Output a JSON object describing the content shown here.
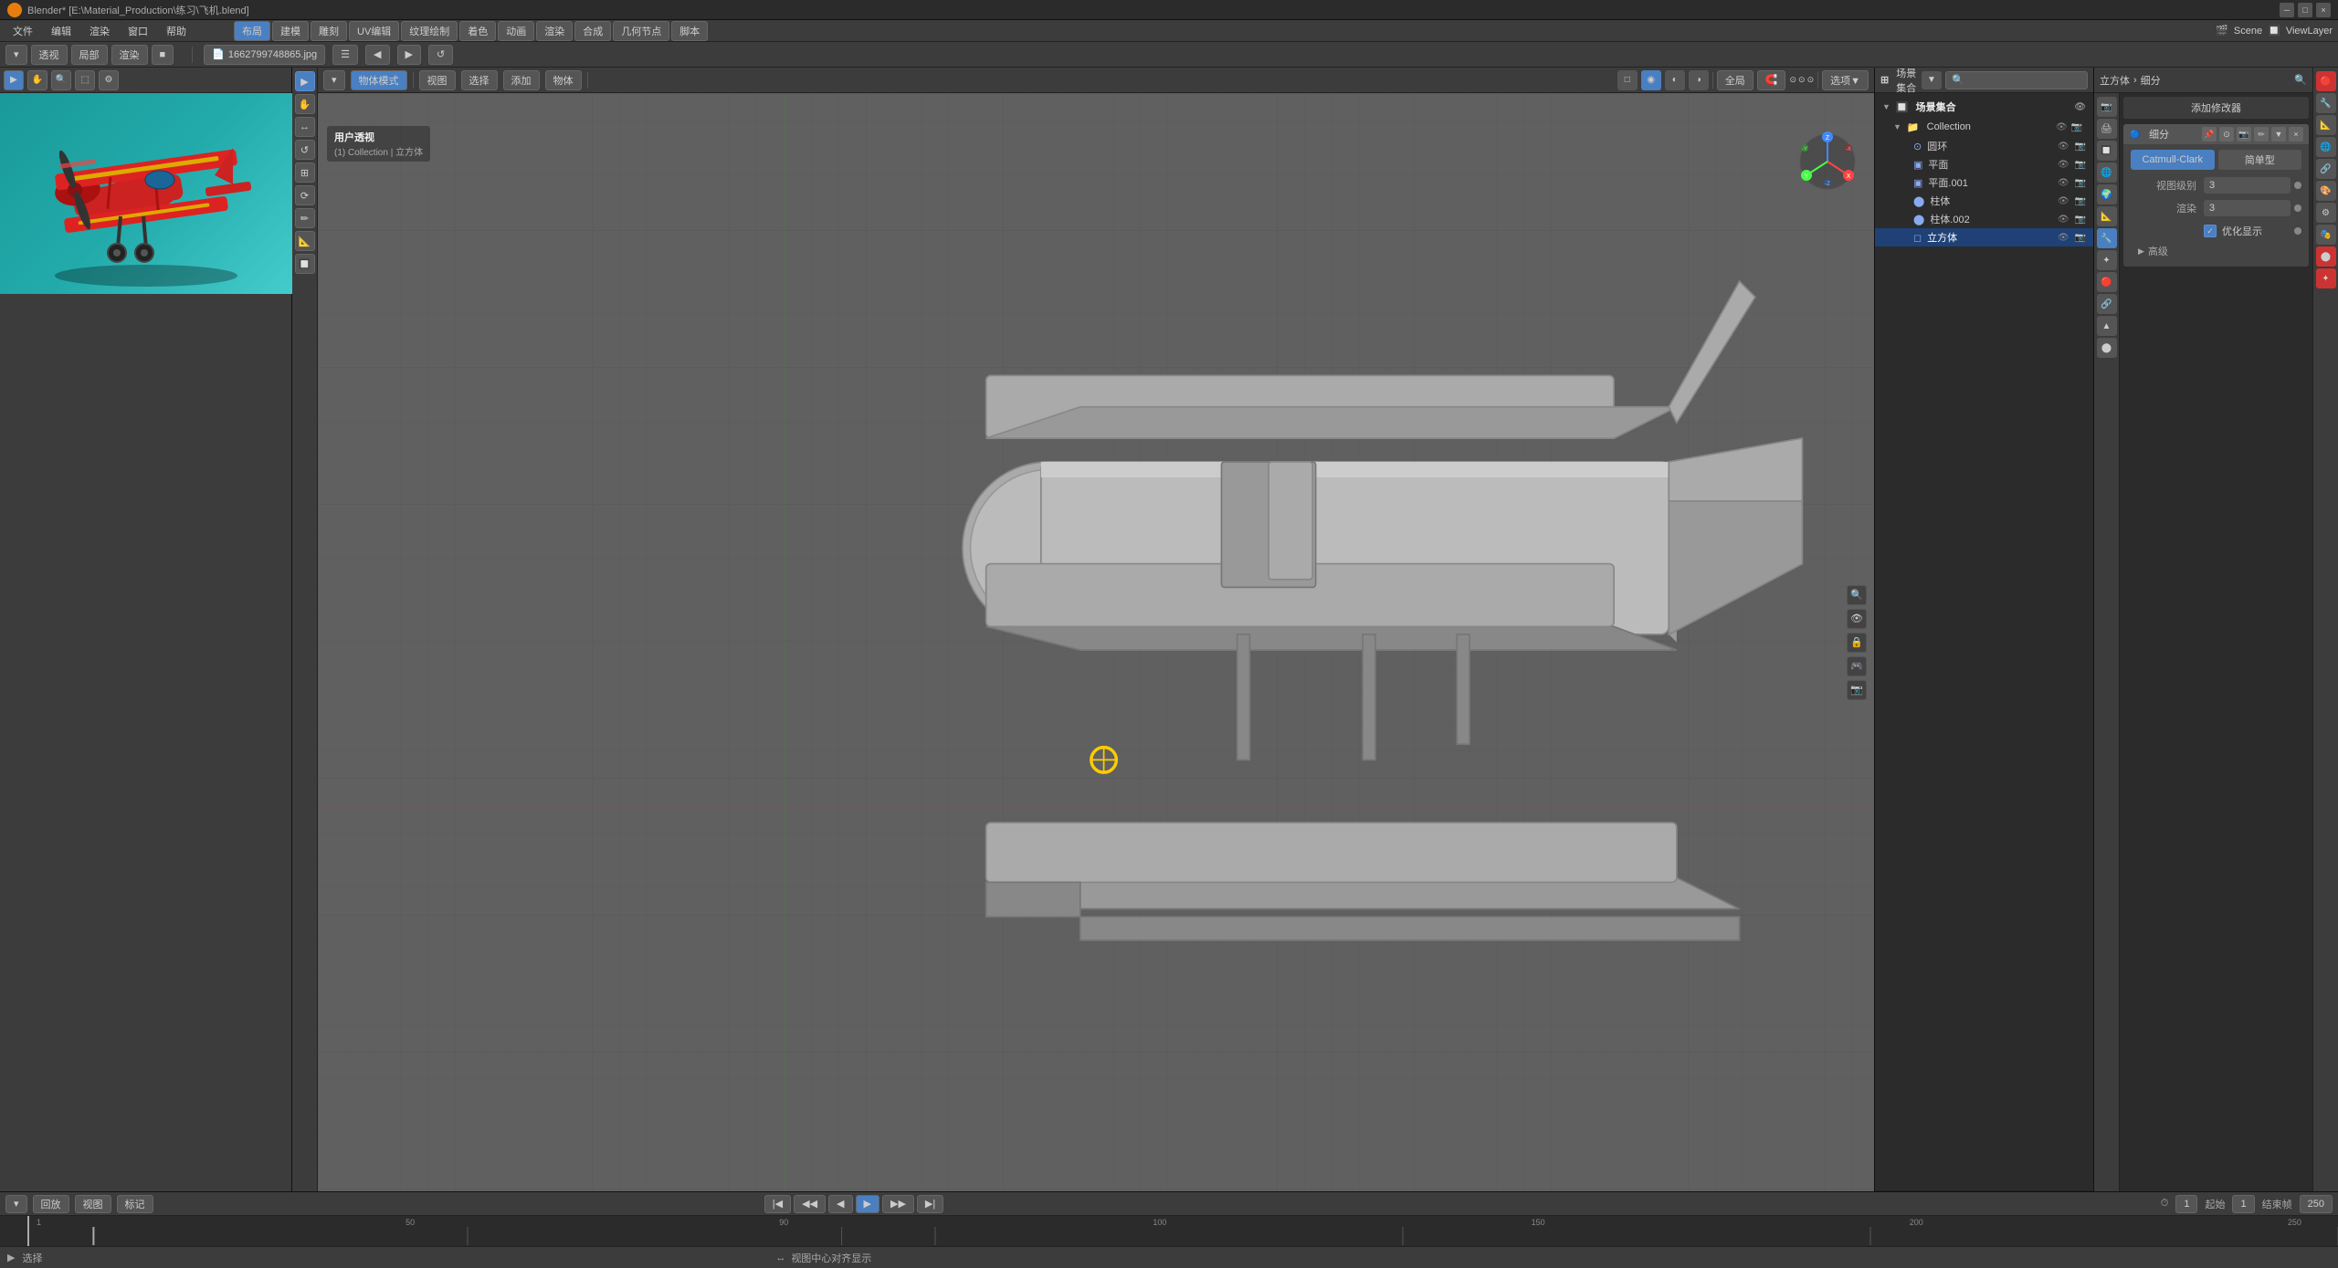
{
  "titleBar": {
    "title": "Blender* [E:\\Material_Production\\练习\\飞机.blend]",
    "icon": "blender-icon"
  },
  "menuBar": {
    "items": [
      "文件",
      "编辑",
      "渲染",
      "窗口",
      "帮助"
    ]
  },
  "topToolbar": {
    "workspaces": [
      "布局",
      "建模",
      "雕刻",
      "UV编辑",
      "纹理绘制",
      "着色",
      "动画",
      "渲染",
      "合成",
      "几何节点",
      "脚本"
    ],
    "scene": "Scene",
    "viewLayer": "ViewLayer",
    "filename": "1662799748865.jpg"
  },
  "leftPanel": {
    "toolButtons": [
      "▶",
      "✋",
      "↔",
      "↺",
      "⊞",
      "⟳",
      "✏",
      "📐",
      "🔲"
    ],
    "activeButton": "▶"
  },
  "viewport": {
    "mode": "物体模式",
    "viewType": "用户透视",
    "collection": "(1) Collection | 立方体",
    "menus": [
      "视图",
      "选择",
      "添加",
      "物体"
    ],
    "headerButtons": [
      "物体模式",
      "视图",
      "选择",
      "添加",
      "物体"
    ],
    "shading": {
      "wireframe": "□",
      "solid": "◉",
      "material": "◐",
      "rendered": "◑"
    },
    "navGizmo": {
      "x": "X",
      "y": "Y",
      "z": "Z",
      "negX": "-X",
      "negY": "-Y",
      "negZ": "-Z"
    },
    "overlaysBtn": "选项▼",
    "globalBtn": "全局",
    "snapBtn": "🧲"
  },
  "outliner": {
    "title": "场景集合",
    "searchPlaceholder": "",
    "collections": [
      {
        "name": "Collection",
        "expanded": true,
        "items": [
          {
            "name": "圆环",
            "type": "mesh",
            "visible": true
          },
          {
            "name": "平面",
            "type": "mesh",
            "visible": true
          },
          {
            "name": "平面.001",
            "type": "mesh",
            "visible": true
          },
          {
            "name": "柱体",
            "type": "mesh",
            "visible": true
          },
          {
            "name": "柱体.002",
            "type": "mesh",
            "visible": true
          },
          {
            "name": "立方体",
            "type": "mesh",
            "visible": true,
            "selected": true
          }
        ]
      }
    ]
  },
  "properties": {
    "breadcrumb": [
      "立方体",
      "细分"
    ],
    "addModifierLabel": "添加修改器",
    "modifiers": [
      {
        "name": "细分",
        "type": "subdivision",
        "enabled": true,
        "algorithm": "Catmull-Clark",
        "algorithmLabel": "Catmull-Clark",
        "simpleLabel": "简单型",
        "viewportLevels": 3,
        "viewportLevelsLabel": "视图级别",
        "renderLevels": 3,
        "renderLabel": "渲染",
        "optimizeDisplay": true,
        "optimizeLabel": "优化显示",
        "advanced": "高级",
        "advancedExpanded": false
      }
    ],
    "icons": [
      "🎬",
      "🔧",
      "📐",
      "🌐",
      "🎨",
      "🔗",
      "⚙",
      "🎭",
      "🔴",
      "💫"
    ]
  },
  "timeline": {
    "playbackBtn": "回放",
    "viewBtn": "视图",
    "markerBtn": "标记",
    "currentFrame": 1,
    "startFrame": 1,
    "endFrame": 250,
    "startLabel": "起始",
    "endLabel": "结束帧",
    "markers": [
      1,
      50,
      90,
      100,
      150,
      200,
      250
    ],
    "markerLabels": [
      "1",
      "50",
      "90",
      "100",
      "150",
      "200",
      "250"
    ],
    "transportButtons": [
      "|◀",
      "◀◀",
      "◀",
      "▶",
      "▶▶",
      "▶|"
    ],
    "frameNumbers": [
      "1",
      "50",
      "90",
      "100",
      "150",
      "200",
      "250"
    ]
  },
  "statusBar": {
    "selectionInfo": "选择",
    "pivotCenter": "视图中心对齐显示",
    "coordsLabel": ""
  },
  "colors": {
    "accent": "#4a7fc1",
    "background": "#1a1a1a",
    "panelBg": "#2b2b2b",
    "toolbarBg": "#3c3c3c",
    "viewport": "#606060",
    "gridColor": "#555555",
    "selected": "#1f4175",
    "modifierBg": "#444444"
  }
}
